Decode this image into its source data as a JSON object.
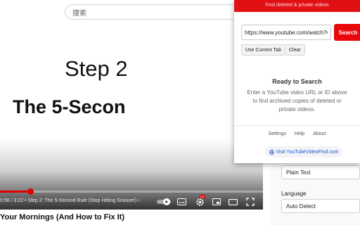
{
  "page": {
    "search_placeholder": "搜索"
  },
  "video": {
    "slide_title": "Step 2",
    "slide_subtitle": "The 5-Secon",
    "progress_fraction": 0.115,
    "time": "0:56 / 3:22",
    "chapter": " • Step 2: The 5-Second Rule (Stop Hitting Snooze!)",
    "chapter_arrow": "›",
    "title": "Your Mornings (And How to Fix It)"
  },
  "controls": {
    "play_icon": "play-icon",
    "subtitles_icon": "subtitles-icon",
    "settings_badge": "HD",
    "icons": [
      "autoplay-toggle-icon",
      "subtitles-icon",
      "settings-icon",
      "miniplayer-icon",
      "theater-icon",
      "cast-icon",
      "fullscreen-icon"
    ]
  },
  "side": {
    "format_value": "Plain Text",
    "language_label": "Language",
    "language_value": "Auto Detect"
  },
  "popup": {
    "header": "Find deleted & private videos",
    "url_value": "https://www.youtube.com/watch?v=abc",
    "search_label": "Search",
    "use_tab_label": "Use Current Tab",
    "clear_label": "Clear",
    "ready_title": "Ready to Search",
    "ready_desc": "Enter a YouTube video URL or ID above to find archived copies of deleted or private videos.",
    "settings_label": "Settings",
    "help_label": "Help",
    "about_label": "About",
    "visit_label": "Visit YouTubeVideoFind.com",
    "accent": "#e8070c"
  }
}
